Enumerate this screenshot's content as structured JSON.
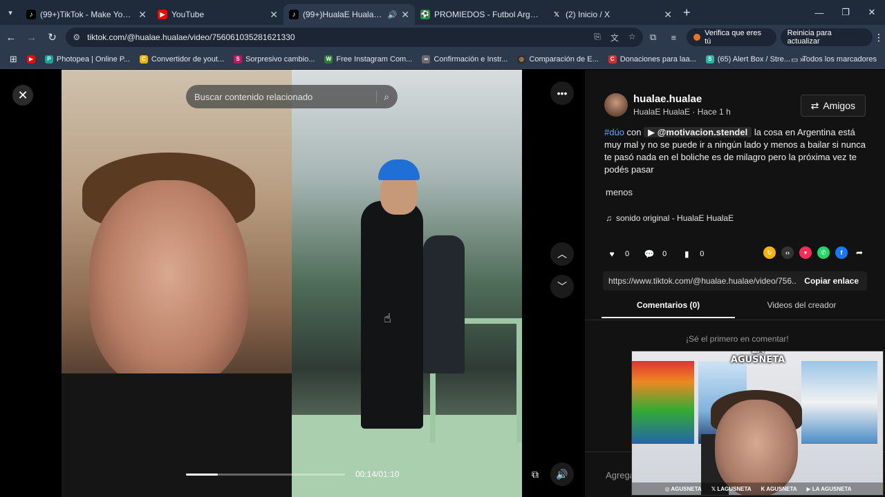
{
  "browser": {
    "tabs": [
      {
        "title": "(99+)TikTok - Make Your Day",
        "favicon": "tiktok-icon",
        "active": false
      },
      {
        "title": "YouTube",
        "favicon": "youtube-icon",
        "active": false
      },
      {
        "title": "(99+)HualaE HualaE (@hual",
        "favicon": "tiktok-icon",
        "active": true
      },
      {
        "title": "PROMIEDOS - Futbol Argentino",
        "favicon": "promiedos-icon",
        "active": false
      },
      {
        "title": "(2) Inicio / X",
        "favicon": "x-icon",
        "active": false
      }
    ],
    "url": "tiktok.com/@hualae.hualae/video/756061035281621330",
    "verify_label": "Verifica que eres tú",
    "restart_label": "Reinicia para actualizar",
    "bookmarks": [
      {
        "label": "",
        "color": "#ff0000"
      },
      {
        "label": "Photopea | Online P...",
        "color": "#18a497"
      },
      {
        "label": "Convertidor de yout...",
        "color": "#f2b600"
      },
      {
        "label": "Sorpresivo cambio...",
        "color": "#c2185b"
      },
      {
        "label": "Free Instagram Com...",
        "color": "#2e7d32"
      },
      {
        "label": "Confirmación e Instr...",
        "color": "#6b6b6b"
      },
      {
        "label": "Comparación de E...",
        "color": "#3a2e22"
      },
      {
        "label": "Donaciones para laa...",
        "color": "#d32f2f"
      },
      {
        "label": "(65) Alert Box / Stre...",
        "color": "#22b8a4"
      }
    ],
    "all_bookmarks": "Todos los marcadores"
  },
  "video": {
    "search_placeholder": "Buscar contenido relacionado",
    "time": "00:14/01:10",
    "progress": 0.2
  },
  "post": {
    "username": "hualae.hualae",
    "subline": "HualaE HualaE · Hace 1 h",
    "friends_label": "Amigos",
    "tag": "#dúo",
    "with": "con",
    "mention": "@motivacion.stendel",
    "text": "la cosa en Argentina está muy mal y no se puede ir a ningún lado y menos a bailar si nunca te pasó nada en el boliche es de milagro pero la próxima vez te podés pasar",
    "more": "menos",
    "sound": "sonido original - HualaE HualaE",
    "likes": "0",
    "comments": "0",
    "saves": "0",
    "link": "https://www.tiktok.com/@hualae.hualae/video/756...",
    "copy_label": "Copiar enlace",
    "tab_comments": "Comentarios (0)",
    "tab_videos": "Videos del creador",
    "empty_comments": "¡Sé el primero en comentar!",
    "add_comment": "Agrega"
  },
  "webcam": {
    "logo_line1": "LA",
    "logo_line2": "AGUSNETA",
    "footer": [
      "AGUSNETA",
      "LAGUSNETA",
      "AGUSNETA",
      "LA AGUSNETA"
    ]
  }
}
